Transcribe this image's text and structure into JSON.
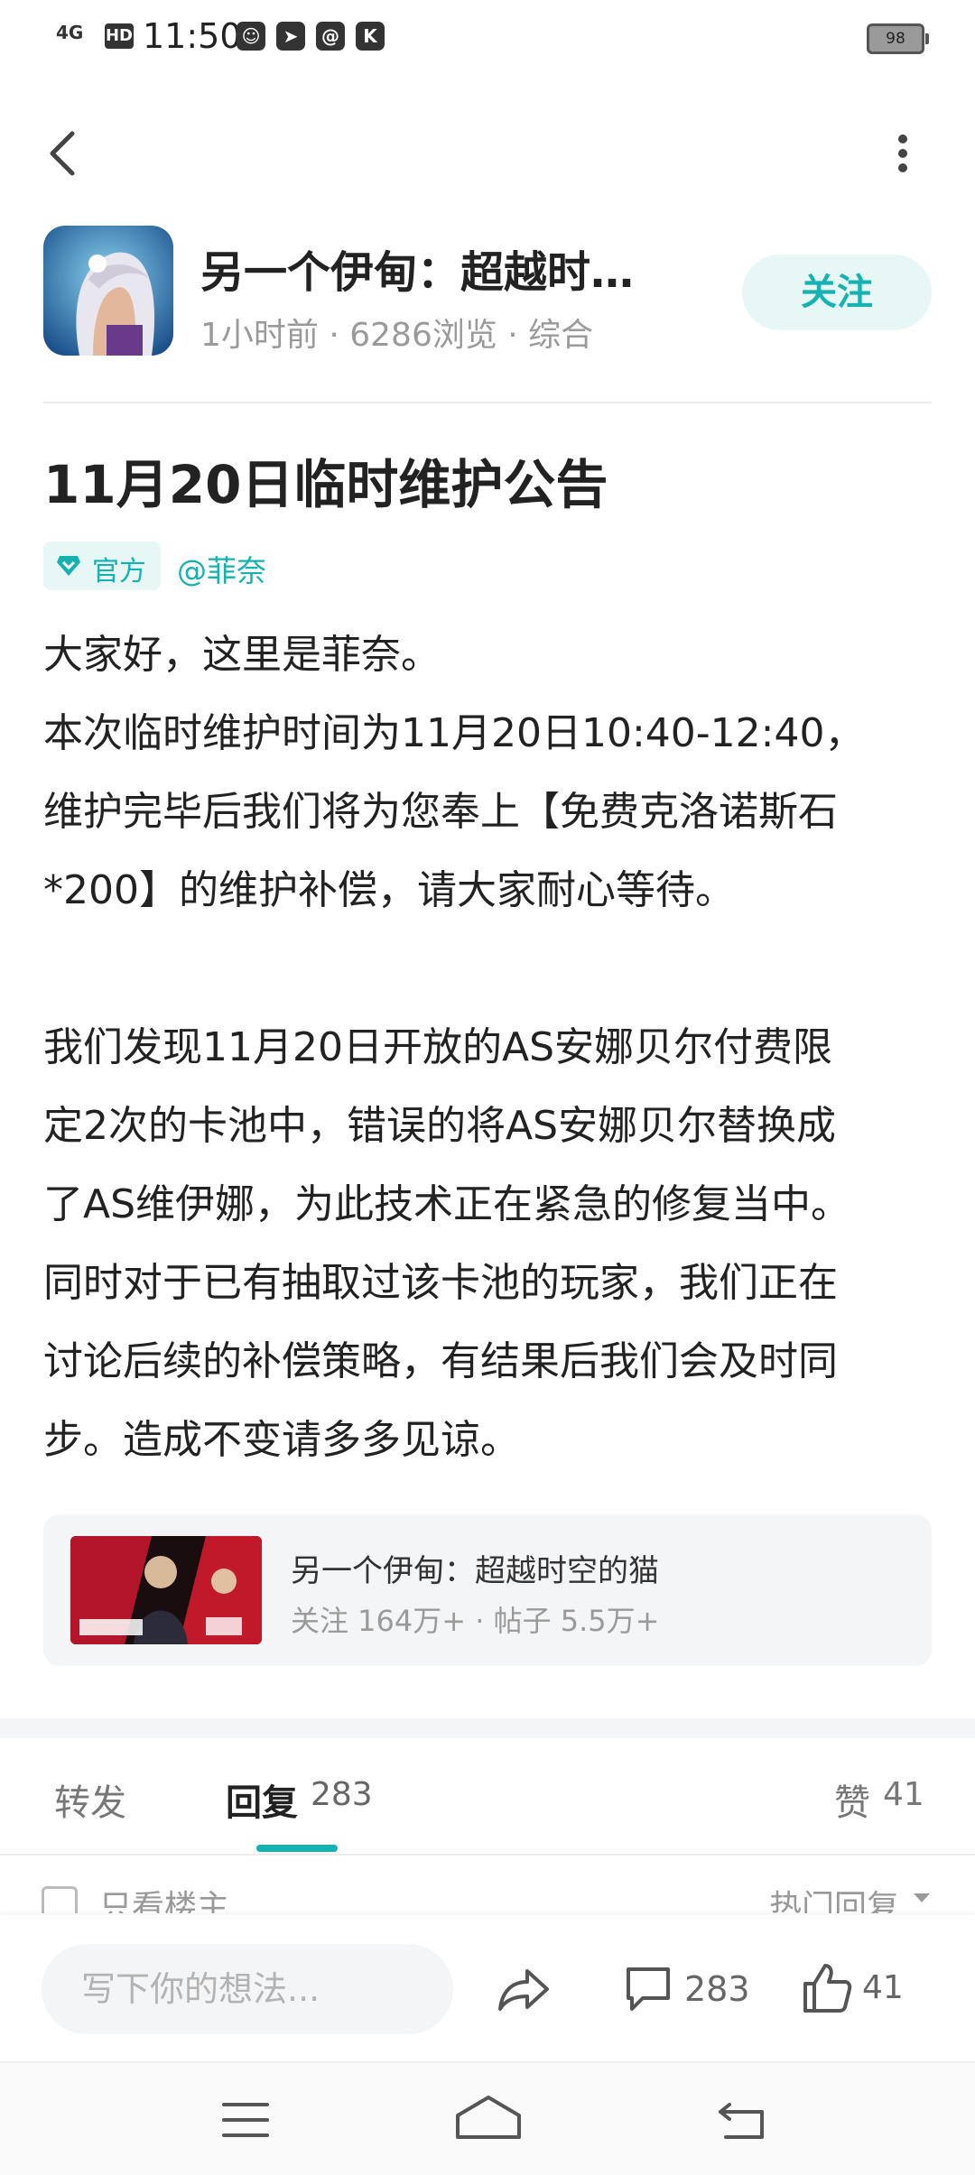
{
  "status_bar": {
    "signal": "4G",
    "hd": "HD",
    "time": "11:50",
    "battery": "98",
    "icons": [
      "cat-app-icon",
      "telegram-icon",
      "search-app-icon",
      "k-app-icon"
    ]
  },
  "header": {
    "back_icon": "chevron-left-icon",
    "more_icon": "vertical-dots-icon"
  },
  "author": {
    "name": "另一个伊甸：超越时…",
    "meta": "1小时前 · 6286浏览 · 综合",
    "follow_label": "关注"
  },
  "post": {
    "title": "11月20日临时维护公告",
    "official_tag": "官方",
    "mention": "@菲奈",
    "lines": [
      "大家好，这里是菲奈。",
      "本次临时维护时间为11月20日10:40-12:40，",
      "维护完毕后我们将为您奉上【免费克洛诺斯石",
      "*200】的维护补偿，请大家耐心等待。",
      "",
      "我们发现11月20日开放的AS安娜贝尔付费限",
      "定2次的卡池中，错误的将AS安娜贝尔替换成",
      "了AS维伊娜，为此技术正在紧急的修复当中。",
      "同时对于已有抽取过该卡池的玩家，我们正在",
      "讨论后续的补偿策略，有结果后我们会及时同",
      "步。造成不变请多多见谅。"
    ]
  },
  "game_card": {
    "title": "另一个伊甸：超越时空的猫",
    "meta": "关注 164万+ · 帖子 5.5万+"
  },
  "tabs": {
    "repost": "转发",
    "reply": "回复",
    "reply_count": "283",
    "like": "赞",
    "like_count": "41"
  },
  "filter": {
    "only_op": "只看楼主",
    "sort": "热门回复"
  },
  "bottom_bar": {
    "placeholder": "写下你的想法...",
    "comment_count": "283",
    "like_count": "41"
  },
  "colors": {
    "accent": "#16b1b1",
    "accent_bg": "#e7f7f6",
    "muted": "#9a9a9a"
  }
}
